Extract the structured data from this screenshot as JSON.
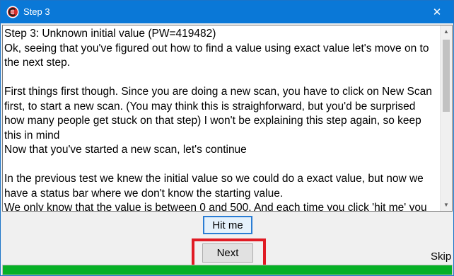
{
  "window": {
    "title": "Step 3",
    "close_glyph": "✕",
    "icon": "cheat-engine-icon",
    "titlebar_color": "#0a78d7"
  },
  "tutorial_text": "Step 3: Unknown initial value (PW=419482)\nOk, seeing that you've figured out how to find a value using exact value let's move on to the next step.\n\nFirst things first though. Since you are doing a new scan, you have to click on New Scan first, to start a new scan. (You may think this is straighforward, but you'd be surprised how many people get stuck on that step) I won't be explaining this step again, so keep this in mind\nNow that you've started a new scan, let's continue\n\nIn the previous test we knew the initial value so we could do a exact value, but now we have a status bar where we don't know the starting value.\nWe only know that the value is between 0 and 500. And each time you click 'hit me' you",
  "buttons": {
    "hit_me": "Hit me",
    "next": "Next",
    "skip": "Skip"
  },
  "progress": {
    "fraction": 1.0,
    "color": "#06b025"
  },
  "highlight_color": "#e01b24"
}
